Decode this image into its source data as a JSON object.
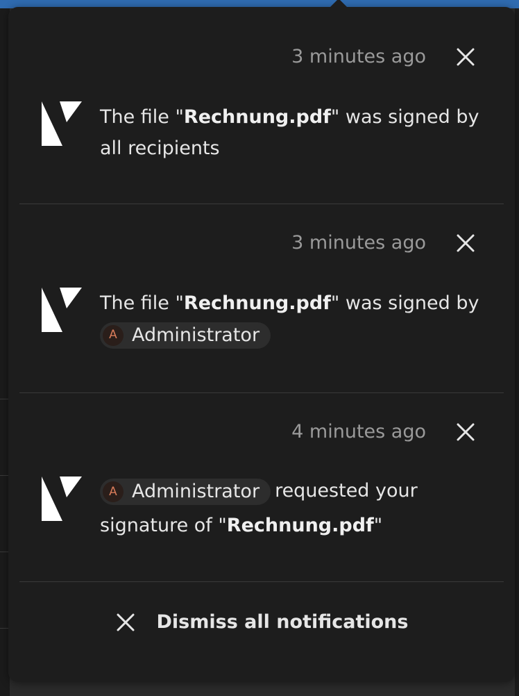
{
  "notifications": [
    {
      "time": "3 minutes ago",
      "text_prefix": "The file \"",
      "file": "Rechnung.pdf",
      "text_suffix": "\" was signed by",
      "text_line2": "all recipients"
    },
    {
      "time": "3 minutes ago",
      "text_prefix": "The file \"",
      "file": "Rechnung.pdf",
      "text_suffix": "\" was signed by",
      "user_initial": "A",
      "user_name": "Administrator"
    },
    {
      "time": "4 minutes ago",
      "user_initial": "A",
      "user_name": "Administrator",
      "text_after_user": "requested your",
      "text_line2_prefix": "signature of \"",
      "file": "Rechnung.pdf",
      "text_line2_suffix": "\""
    }
  ],
  "dismiss_all_label": "Dismiss all notifications",
  "icons": {
    "close": "close-icon",
    "app": "sign-app-icon"
  },
  "colors": {
    "panel": "#1d1d1d",
    "text": "#e6e6e6",
    "muted": "#9a9a9a",
    "divider": "#3a3a3a",
    "avatar_text": "#d97c5a"
  }
}
